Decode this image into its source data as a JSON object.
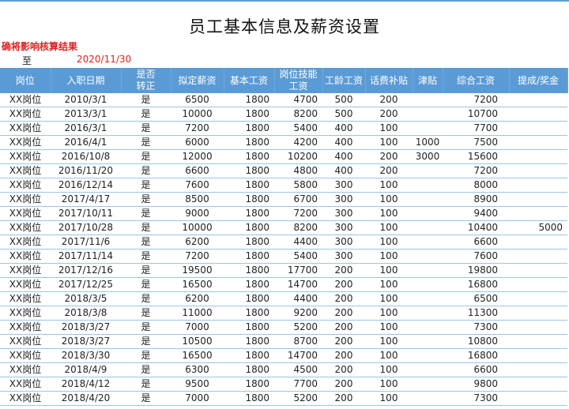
{
  "title": "员工基本信息及薪资设置",
  "warning": "确将影响核算结果",
  "as_of": {
    "label": "至",
    "date": "2020/11/30"
  },
  "columns": [
    "岗位",
    "入职日期",
    "是否\n转正",
    "拟定薪资",
    "基本工资",
    "岗位技能\n工资",
    "工龄工资",
    "话费补贴",
    "津贴",
    "综合工资",
    "提成/奖金"
  ],
  "rows": [
    [
      "XX岗位",
      "2010/3/1",
      "是",
      "6500",
      "1800",
      "4700",
      "500",
      "200",
      "",
      "7200",
      ""
    ],
    [
      "XX岗位",
      "2013/3/1",
      "是",
      "10000",
      "1800",
      "8200",
      "500",
      "200",
      "",
      "10700",
      ""
    ],
    [
      "XX岗位",
      "2016/3/1",
      "是",
      "7200",
      "1800",
      "5400",
      "400",
      "100",
      "",
      "7700",
      ""
    ],
    [
      "XX岗位",
      "2016/4/1",
      "是",
      "6000",
      "1800",
      "4200",
      "400",
      "100",
      "1000",
      "7500",
      ""
    ],
    [
      "XX岗位",
      "2016/10/8",
      "是",
      "12000",
      "1800",
      "10200",
      "400",
      "200",
      "3000",
      "15600",
      ""
    ],
    [
      "XX岗位",
      "2016/11/20",
      "是",
      "6600",
      "1800",
      "4800",
      "400",
      "200",
      "",
      "7200",
      ""
    ],
    [
      "XX岗位",
      "2016/12/14",
      "是",
      "7600",
      "1800",
      "5800",
      "300",
      "100",
      "",
      "8000",
      ""
    ],
    [
      "XX岗位",
      "2017/4/17",
      "是",
      "8500",
      "1800",
      "6700",
      "300",
      "100",
      "",
      "8900",
      ""
    ],
    [
      "XX岗位",
      "2017/10/11",
      "是",
      "9000",
      "1800",
      "7200",
      "300",
      "100",
      "",
      "9400",
      ""
    ],
    [
      "XX岗位",
      "2017/10/28",
      "是",
      "10000",
      "1800",
      "8200",
      "300",
      "100",
      "",
      "10400",
      "5000"
    ],
    [
      "XX岗位",
      "2017/11/6",
      "是",
      "6200",
      "1800",
      "4400",
      "300",
      "100",
      "",
      "6600",
      ""
    ],
    [
      "XX岗位",
      "2017/11/14",
      "是",
      "7200",
      "1800",
      "5400",
      "300",
      "100",
      "",
      "7600",
      ""
    ],
    [
      "XX岗位",
      "2017/12/16",
      "是",
      "19500",
      "1800",
      "17700",
      "200",
      "100",
      "",
      "19800",
      ""
    ],
    [
      "XX岗位",
      "2017/12/25",
      "是",
      "16500",
      "1800",
      "14700",
      "200",
      "100",
      "",
      "16800",
      ""
    ],
    [
      "XX岗位",
      "2018/3/5",
      "是",
      "6200",
      "1800",
      "4400",
      "200",
      "100",
      "",
      "6500",
      ""
    ],
    [
      "XX岗位",
      "2018/3/8",
      "是",
      "11000",
      "1800",
      "9200",
      "200",
      "100",
      "",
      "11300",
      ""
    ],
    [
      "XX岗位",
      "2018/3/27",
      "是",
      "7000",
      "1800",
      "5200",
      "200",
      "100",
      "",
      "7300",
      ""
    ],
    [
      "XX岗位",
      "2018/3/27",
      "是",
      "10500",
      "1800",
      "8700",
      "200",
      "100",
      "",
      "10800",
      ""
    ],
    [
      "XX岗位",
      "2018/3/30",
      "是",
      "16500",
      "1800",
      "14700",
      "200",
      "100",
      "",
      "16800",
      ""
    ],
    [
      "XX岗位",
      "2018/4/9",
      "是",
      "6300",
      "1800",
      "4500",
      "200",
      "100",
      "",
      "6600",
      ""
    ],
    [
      "XX岗位",
      "2018/4/12",
      "是",
      "9500",
      "1800",
      "7700",
      "200",
      "100",
      "",
      "9800",
      ""
    ],
    [
      "XX岗位",
      "2018/4/20",
      "是",
      "7000",
      "1800",
      "5200",
      "200",
      "100",
      "",
      "7300",
      ""
    ]
  ]
}
